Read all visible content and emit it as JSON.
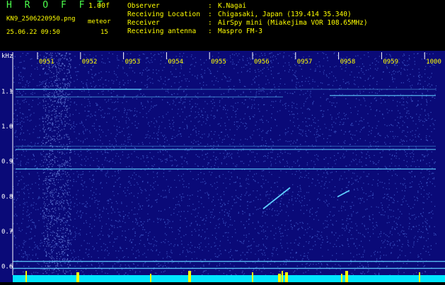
{
  "header": {
    "app_title": "H R O F F T",
    "version": "1.00f",
    "filename": "KN9_2506220950.png",
    "datetime": "25.06.22 09:50",
    "meteor_label": "meteor",
    "meteor_count": "15",
    "info": [
      {
        "key": "Observer",
        "sep": ":",
        "value": "K.Nagai"
      },
      {
        "key": "Receiving Location",
        "sep": ":",
        "value": "Chigasaki, Japan (139.414 35.340)"
      },
      {
        "key": "Receiver",
        "sep": ":",
        "value": "AirSpy mini (Miakejima VOR 108.65MHz)"
      },
      {
        "key": "Receiving antenna",
        "sep": ":",
        "value": "Maspro FM-3"
      }
    ]
  },
  "spectrogram": {
    "y_unit": "kHz",
    "y_ticks": [
      "1.1",
      "1.0",
      "0.9",
      "0.8",
      "0.7",
      "0.6"
    ],
    "time_ticks": [
      "0951",
      "0952",
      "0953",
      "0954",
      "0955",
      "0956",
      "0957",
      "0958",
      "0959",
      "1000"
    ],
    "colors": {
      "background": "#0a0a78",
      "noise": "#4a6ad8",
      "line": "#5fd0ff",
      "baseline": "#00e5ff",
      "burst": "#ffff00",
      "tick_text": "#ffff00",
      "axis_text": "#ffffff"
    }
  }
}
